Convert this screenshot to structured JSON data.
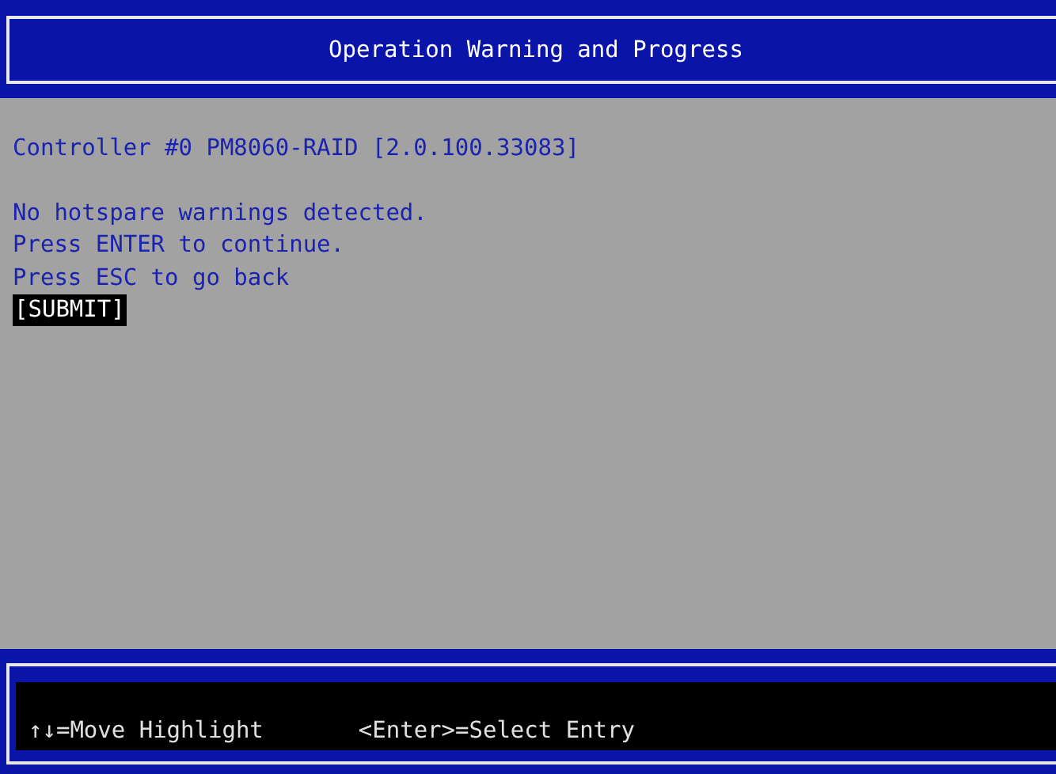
{
  "header": {
    "title": "Operation Warning and Progress"
  },
  "controller": "Controller #0 PM8060-RAID [2.0.100.33083]",
  "messages": [
    "No hotspare warnings detected.",
    "Press ENTER to continue.",
    "Press ESC to go back"
  ],
  "submit": {
    "label": "[SUBMIT]",
    "selected": true
  },
  "footer": {
    "hints": [
      "↑↓=Move Highlight",
      "<Enter>=Select Entry"
    ]
  }
}
